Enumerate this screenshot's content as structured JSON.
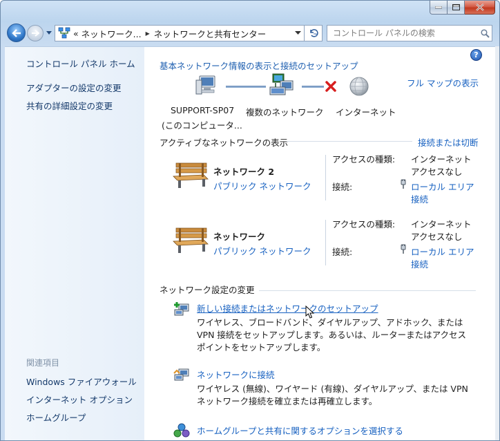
{
  "nav": {
    "breadcrumb": [
      "«",
      "ネットワーク...",
      "ネットワークと共有センター"
    ],
    "search_placeholder": "コントロール パネルの検索"
  },
  "sidebar": {
    "home": "コントロール パネル ホーム",
    "items": [
      "アダプターの設定の変更",
      "共有の詳細設定の変更"
    ],
    "related_header": "関連項目",
    "related": [
      "Windows ファイアウォール",
      "インターネット オプション",
      "ホームグループ"
    ]
  },
  "main": {
    "title": "基本ネットワーク情報の表示と接続のセットアップ",
    "full_map": "フル マップの表示",
    "map": {
      "computer_line1": "SUPPORT-SP07",
      "computer_line2": "(このコンピュータ...",
      "middle": "複数のネットワーク",
      "internet": "インターネット"
    },
    "active_header": "アクティブなネットワークの表示",
    "connect_link": "接続または切断",
    "networks": [
      {
        "name": "ネットワーク  2",
        "type": "パブリック ネットワーク",
        "access_label": "アクセスの種類:",
        "access_value_1": "インターネット",
        "access_value_2": "アクセスなし",
        "conn_label": "接続:",
        "conn_value_1": "ローカル エリア",
        "conn_value_2": "接続"
      },
      {
        "name": "ネットワーク",
        "type": "パブリック ネットワーク",
        "access_label": "アクセスの種類:",
        "access_value_1": "インターネット",
        "access_value_2": "アクセスなし",
        "conn_label": "接続:",
        "conn_value_1": "ローカル エリア",
        "conn_value_2": "接続"
      }
    ],
    "change_header": "ネットワーク設定の変更",
    "tasks": [
      {
        "title": "新しい接続またはネットワークのセットアップ",
        "desc": "ワイヤレス、ブロードバンド、ダイヤルアップ、アドホック、または VPN 接続をセットアップします。あるいは、ルーターまたはアクセス ポイントをセットアップします。"
      },
      {
        "title": "ネットワークに接続",
        "desc": "ワイヤレス (無線)、ワイヤード (有線)、ダイヤルアップ、または VPN ネットワーク接続を確立または再確立します。"
      },
      {
        "title": "ホームグループと共有に関するオプションを選択する",
        "desc": ""
      }
    ]
  }
}
